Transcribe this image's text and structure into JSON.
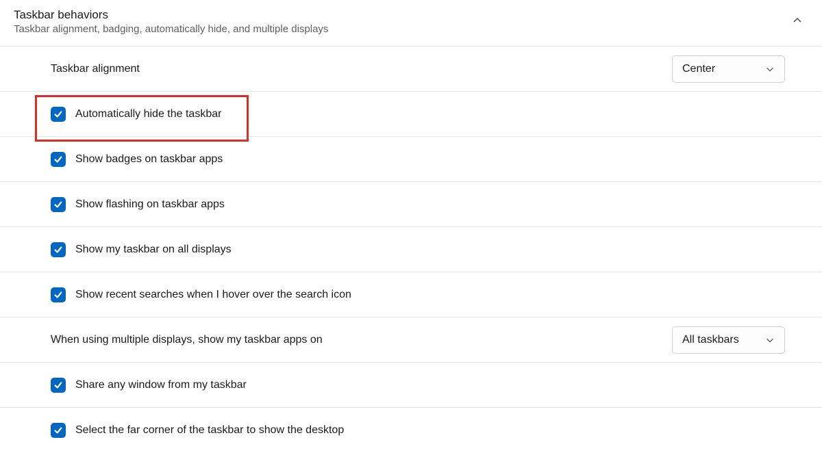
{
  "header": {
    "title": "Taskbar behaviors",
    "subtitle": "Taskbar alignment, badging, automatically hide, and multiple displays"
  },
  "settings": {
    "alignment": {
      "label": "Taskbar alignment",
      "value": "Center"
    },
    "multiDisplays": {
      "label": "When using multiple displays, show my taskbar apps on",
      "value": "All taskbars"
    }
  },
  "checkboxes": {
    "autoHide": {
      "label": "Automatically hide the taskbar",
      "checked": true
    },
    "showBadges": {
      "label": "Show badges on taskbar apps",
      "checked": true
    },
    "showFlashing": {
      "label": "Show flashing on taskbar apps",
      "checked": true
    },
    "allDisplays": {
      "label": "Show my taskbar on all displays",
      "checked": true
    },
    "recentSearches": {
      "label": "Show recent searches when I hover over the search icon",
      "checked": true
    },
    "shareWindow": {
      "label": "Share any window from my taskbar",
      "checked": true
    },
    "farCorner": {
      "label": "Select the far corner of the taskbar to show the desktop",
      "checked": true
    }
  }
}
